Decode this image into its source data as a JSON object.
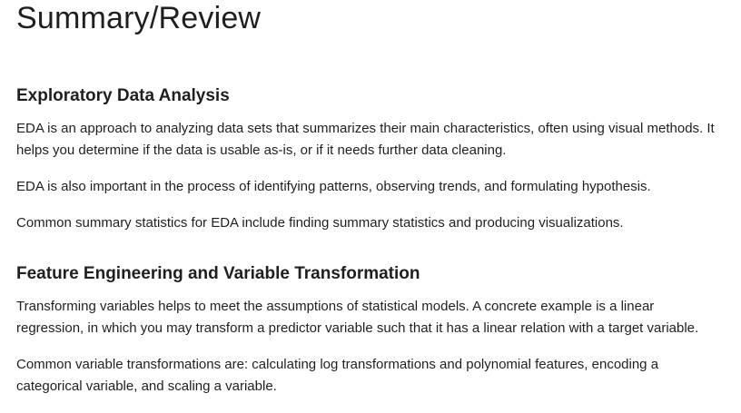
{
  "page": {
    "title": "Summary/Review"
  },
  "sections": [
    {
      "heading": "Exploratory Data Analysis",
      "paragraphs": [
        "EDA is an approach to analyzing data sets that summarizes their main characteristics, often using visual methods. It helps you determine if the data is usable as-is, or if it needs further data cleaning.",
        "EDA is also important in the process of identifying patterns, observing trends, and formulating hypothesis.",
        "Common summary statistics for EDA include finding summary statistics and producing visualizations."
      ]
    },
    {
      "heading": "Feature Engineering and Variable Transformation",
      "paragraphs": [
        "Transforming variables helps to meet the assumptions of statistical models. A concrete example is a linear regression, in which you may transform a predictor variable such that it has a linear relation with a target variable.",
        "Common variable transformations are: calculating log transformations and polynomial features, encoding a categorical variable, and scaling a variable."
      ]
    }
  ]
}
